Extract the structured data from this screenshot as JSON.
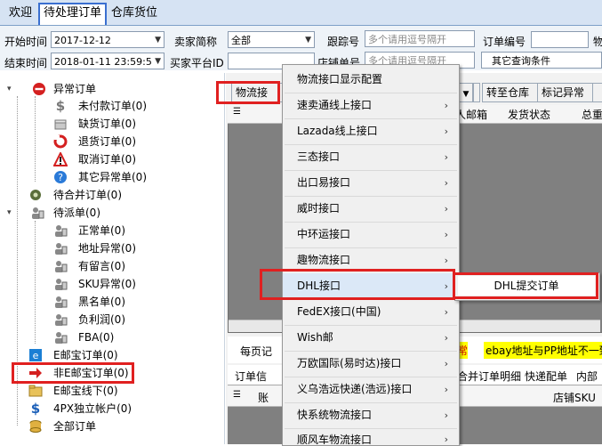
{
  "tabs": [
    {
      "label": "欢迎"
    },
    {
      "label": "待处理订单"
    },
    {
      "label": "仓库货位"
    }
  ],
  "filters": {
    "start_label": "开始时间",
    "start_value": "2017-12-12",
    "end_label": "结束时间",
    "end_value": "2018-01-11 23:59:5",
    "seller_label": "卖家简称",
    "seller_value": "全部",
    "platform_label": "买家平台ID",
    "tracking_label": "跟踪号",
    "tracking_placeholder": "多个请用逗号隔开",
    "store_order_label": "店铺单号",
    "store_order_placeholder": "多个请用逗号隔开",
    "order_no_label": "订单编号",
    "logistics_label": "物",
    "other_conditions": "其它查询条件"
  },
  "tree": {
    "abnormal": "异常订单",
    "unpaid": "未付款订单(0)",
    "out_of_stock": "缺货订单(0)",
    "refund": "退货订单(0)",
    "cancelled": "取消订单(0)",
    "other_abnormal": "其它异常单(0)",
    "to_merge": "待合并订单(0)",
    "to_dispatch": "待派单(0)",
    "normal": "正常单(0)",
    "address_abnormal": "地址异常(0)",
    "has_message": "有留言(0)",
    "sku_abnormal": "SKU异常(0)",
    "blacklist": "黑名单(0)",
    "negative_profit": "负利润(0)",
    "fba": "FBA(0)",
    "ebay_orders": "E邮宝订单(0)",
    "non_ebay_orders": "非E邮宝订单(0)",
    "ebay_offline": "E邮宝线下(0)",
    "fourpx": "4PX独立帐户(0)",
    "all_orders": "全部订单"
  },
  "toolbar": {
    "logistics_btn": "物流接",
    "transfer_btn": "转至仓库",
    "mark_abnormal_btn": "标记异常"
  },
  "grid1": {
    "col_receiver_email": "人邮箱",
    "col_ship_status": "发货状态",
    "col_total": "总重"
  },
  "pager": {
    "per_page": "每页记",
    "warning": "ebay地址与PP地址不一致",
    "abnormal_flag": "常"
  },
  "tabs2": {
    "order_info": "订单信",
    "merged_detail": "合并订单明细",
    "quick_match": "快递配单",
    "internal": "内部"
  },
  "grid2": {
    "col_first": "账",
    "col_store_sku": "店铺SKU"
  },
  "menu": {
    "items": [
      {
        "label": "物流接口显示配置"
      },
      {
        "label": "速卖通线上接口"
      },
      {
        "label": "Lazada线上接口"
      },
      {
        "label": "三态接口"
      },
      {
        "label": "出口易接口"
      },
      {
        "label": "威时接口"
      },
      {
        "label": "中环运接口"
      },
      {
        "label": "趣物流接口"
      },
      {
        "label": "DHL接口"
      },
      {
        "label": "FedEX接口(中国)"
      },
      {
        "label": "Wish邮"
      },
      {
        "label": "万欧国际(易时达)接口"
      },
      {
        "label": "义乌浩远快递(浩远)接口"
      },
      {
        "label": "快系统物流接口"
      },
      {
        "label": "顺风车物流接口"
      }
    ],
    "arrow": "›"
  },
  "submenu": {
    "dhl_submit": "DHL提交订单"
  },
  "colors": {
    "highlight_red": "#e02020",
    "menu_bg": "#f0f0f0",
    "tab_active_border": "#3a6fd0"
  }
}
